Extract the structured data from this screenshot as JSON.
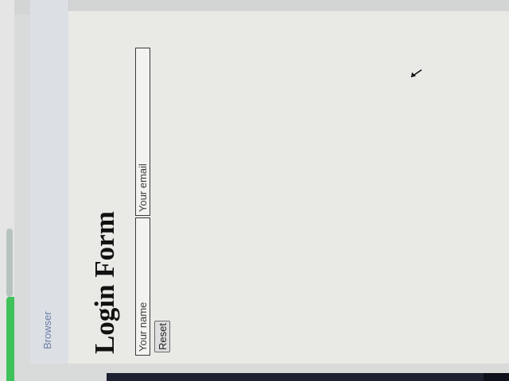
{
  "browser": {
    "title": "Browser"
  },
  "form": {
    "heading": "Login Form",
    "name_placeholder": "Your name",
    "email_placeholder": "Your email",
    "reset_label": "Reset"
  }
}
